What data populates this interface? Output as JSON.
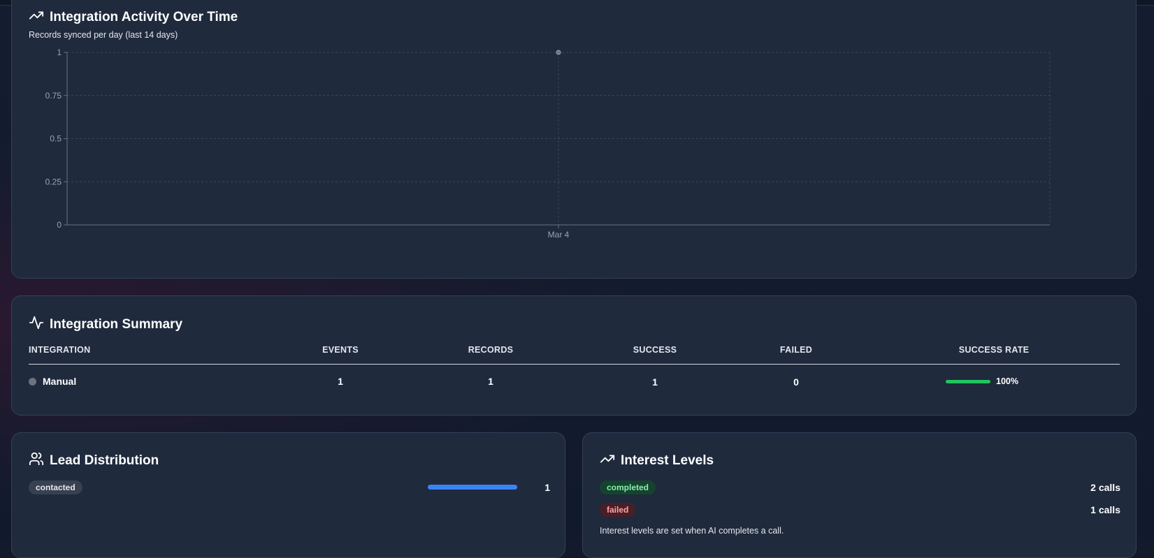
{
  "activity": {
    "title": "Integration Activity Over Time",
    "subtitle": "Records synced per day (last 14 days)",
    "icon": "trending-up-icon"
  },
  "chart_data": {
    "type": "line",
    "x": [
      "Mar 4"
    ],
    "series": [
      {
        "values": [
          1
        ]
      }
    ],
    "y_ticks": [
      "0",
      "0.25",
      "0.5",
      "0.75",
      "1"
    ],
    "ylim": [
      0,
      1
    ],
    "grid": true,
    "title": "Integration Activity Over Time",
    "xlabel": "",
    "ylabel": ""
  },
  "summary": {
    "title": "Integration Summary",
    "icon": "activity-icon",
    "columns": [
      "INTEGRATION",
      "EVENTS",
      "RECORDS",
      "SUCCESS",
      "FAILED",
      "SUCCESS RATE"
    ],
    "rows": [
      {
        "integration": "Manual",
        "events": "1",
        "records": "1",
        "success": "1",
        "failed": "0",
        "success_rate": "100%",
        "success_rate_value": 1.0
      }
    ]
  },
  "leads": {
    "title": "Lead Distribution",
    "icon": "users-icon",
    "items": [
      {
        "label": "contacted",
        "count": "1",
        "fraction": 1.0
      }
    ]
  },
  "interest": {
    "title": "Interest Levels",
    "icon": "trending-up-icon",
    "items": [
      {
        "label": "completed",
        "count": "2 calls",
        "status": "green"
      },
      {
        "label": "failed",
        "count": "1 calls",
        "status": "red"
      }
    ],
    "note": "Interest levels are set when AI completes a call."
  },
  "colors": {
    "accent_blue": "#3b82f6",
    "success_green": "#22c55e",
    "card_bg": "#1f2a3d"
  }
}
